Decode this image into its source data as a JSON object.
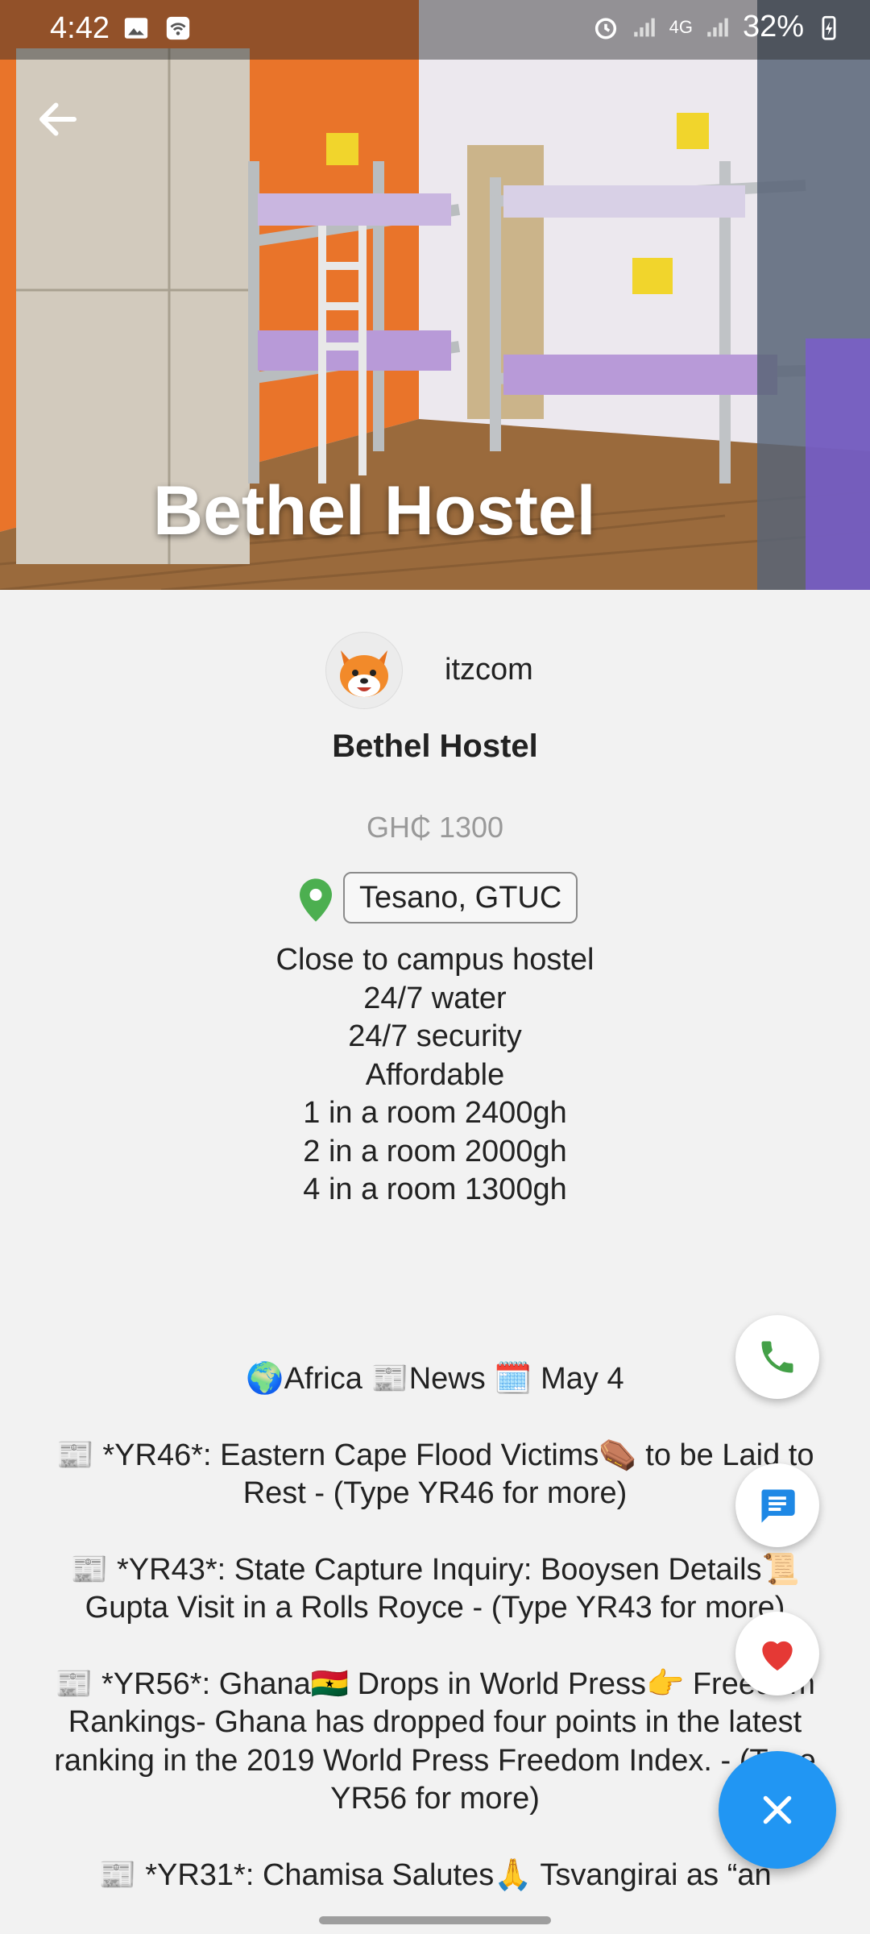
{
  "status_bar": {
    "time": "4:42",
    "network": "4G",
    "battery": "32%"
  },
  "header": {
    "title": "Bethel Hostel"
  },
  "listing": {
    "owner": "itzcom",
    "name": "Bethel Hostel",
    "price": "GH₵ 1300",
    "location": "Tesano, GTUC",
    "description_lines": [
      "Close to campus hostel",
      "24/7 water",
      "24/7 security",
      "Affordable",
      "1 in a room 2400gh",
      "2 in a room 2000gh",
      "4 in a room 1300gh"
    ]
  },
  "news": {
    "header": "🌍Africa 📰News 🗓️ May 4",
    "items": [
      "📰 *YR46*: Eastern Cape Flood Victims⚰️ to be Laid to Rest - (Type YR46 for more)",
      "📰 *YR43*: State Capture Inquiry: Booysen Details📜 Gupta Visit in a Rolls Royce - (Type YR43 for more)",
      "📰 *YR56*: Ghana🇬🇭 Drops in World Press👉 Freedom Rankings- Ghana has dropped four points in the latest ranking in the 2019 World Press Freedom Index. - (Type YR56 for more)",
      "📰 *YR31*: Chamisa Salutes🙏 Tsvangirai as “an"
    ]
  },
  "actions": {
    "call": "phone-icon",
    "message": "chat-icon",
    "favorite": "heart-icon",
    "close": "close-icon"
  },
  "colors": {
    "accent": "#2196F3",
    "phone": "#43A047",
    "heart": "#E53935",
    "pin": "#4CAF50",
    "chat": "#1E88E5"
  }
}
